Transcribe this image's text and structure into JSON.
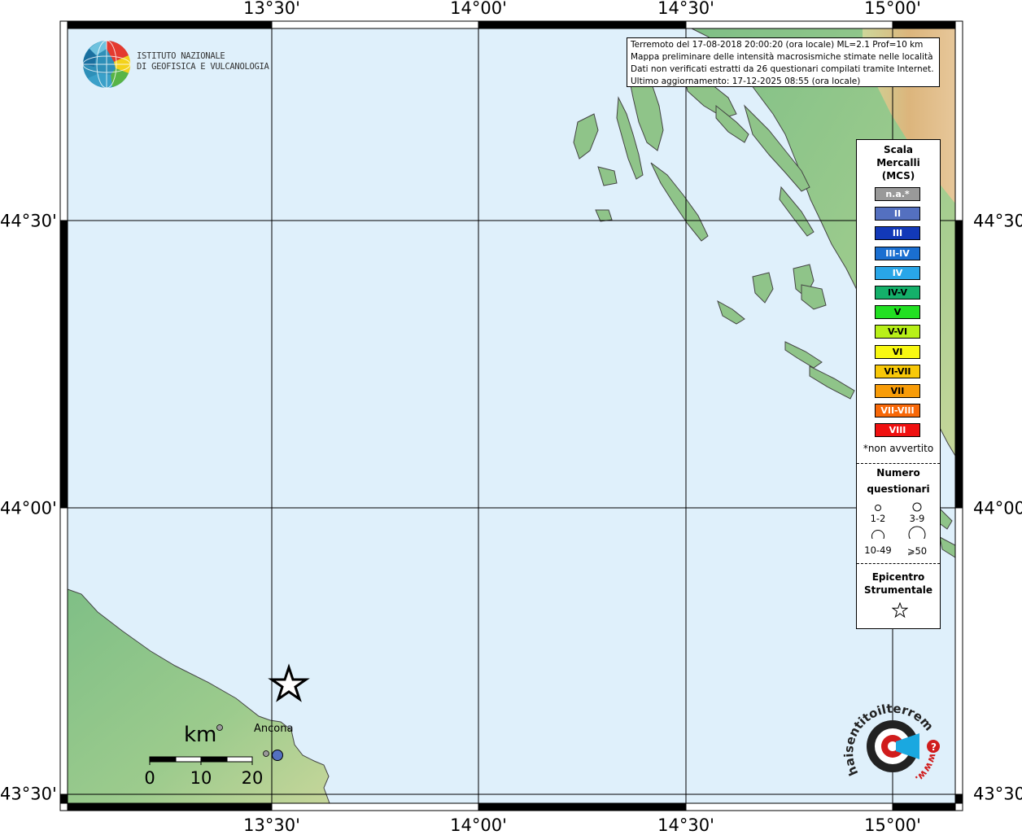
{
  "map": {
    "longitude_labels": [
      "13°30'",
      "14°00'",
      "14°30'",
      "15°00'"
    ],
    "latitude_labels": [
      "44°30'",
      "44°00'",
      "43°30'"
    ],
    "place_label": "Ancona",
    "colors": {
      "sea": "#dff0fb",
      "land_low": "#8fc489",
      "land_mid": "#c8d79a",
      "land_high": "#d9b07a",
      "grid": "#000000"
    }
  },
  "info_box": {
    "line1": "Terremoto del 17-08-2018 20:00:20 (ora locale) ML=2.1 Prof=10 km",
    "line2": "Mappa preliminare delle intensità macrosismiche stimate nelle località",
    "line3": "Dati non verificati estratti da 26 questionari compilati tramite Internet.",
    "line4": "Ultimo aggiornamento: 17-12-2025 08:55 (ora locale)"
  },
  "logo_ingv": {
    "line1": "ISTITUTO NAZIONALE",
    "line2": "DI GEOFISICA E VULCANOLOGIA"
  },
  "legend": {
    "title_line1": "Scala",
    "title_line2": "Mercalli",
    "title_line3": "(MCS)",
    "items": [
      {
        "label": "n.a.*",
        "color": "#999999"
      },
      {
        "label": "II",
        "color": "#5470c0"
      },
      {
        "label": "III",
        "color": "#1239b8"
      },
      {
        "label": "III-IV",
        "color": "#1a6fd1"
      },
      {
        "label": "IV",
        "color": "#29a6e8"
      },
      {
        "label": "IV-V",
        "color": "#14b06a"
      },
      {
        "label": "V",
        "color": "#22e022"
      },
      {
        "label": "V-VI",
        "color": "#b8f018"
      },
      {
        "label": "VI",
        "color": "#f8f811"
      },
      {
        "label": "VI-VII",
        "color": "#f8c808"
      },
      {
        "label": "VII",
        "color": "#f89c08"
      },
      {
        "label": "VII-VIII",
        "color": "#f86808"
      },
      {
        "label": "VIII",
        "color": "#f01010"
      }
    ],
    "footnote": "*non avvertito",
    "count_title_line1": "Numero",
    "count_title_line2": "questionari",
    "count_labels": [
      "1-2",
      "3-9",
      "10-49",
      "⩾50"
    ],
    "epicenter_title_line1": "Epicentro",
    "epicenter_title_line2": "Strumentale",
    "star_icon": "star-outline-icon"
  },
  "scale_bar": {
    "unit": "km",
    "ticks": [
      "0",
      "10",
      "20"
    ]
  },
  "observations": [
    {
      "intensity": "n.a.*",
      "color": "#999999"
    },
    {
      "intensity": "n.a.*",
      "color": "#999999"
    },
    {
      "intensity": "II",
      "color": "#5470c0"
    }
  ],
  "hst_logo": {
    "text": "haisentitoilterremoto.it",
    "url_text": "www.",
    "question_mark": "?"
  }
}
